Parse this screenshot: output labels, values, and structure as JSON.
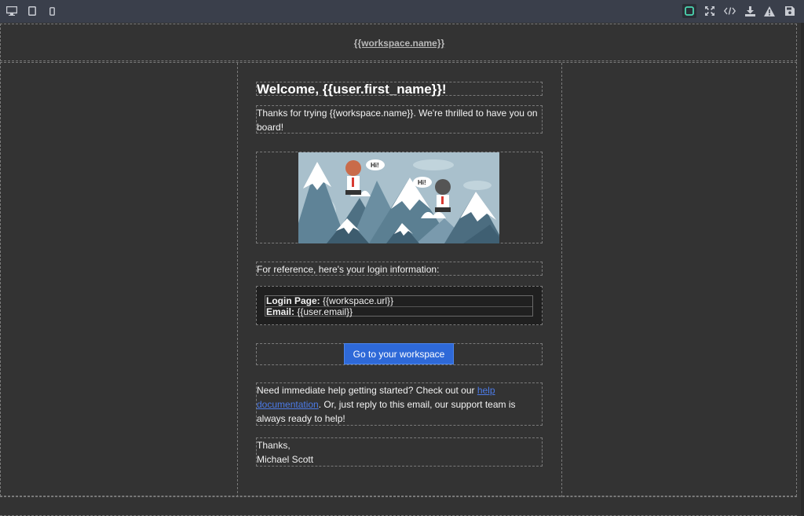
{
  "toolbar": {
    "left_icons": [
      "desktop-icon",
      "tablet-icon",
      "mobile-icon"
    ],
    "right_icons": [
      "outline-toggle-icon",
      "fullscreen-icon",
      "code-icon",
      "import-icon",
      "warning-icon",
      "save-icon"
    ]
  },
  "email": {
    "header_link": "{{workspace.name}}",
    "title": "Welcome, {{user.first_name}}!",
    "intro": "Thanks for trying {{workspace.name}}. We're thrilled to have you on board!",
    "image_alt": "Hi!",
    "bubble_1": "Hi!",
    "bubble_2": "Hi!",
    "reference_text": "For reference, here's your login information:",
    "login_page_label": "Login Page:",
    "login_page_value": "{{workspace.url}}",
    "email_label": "Email:",
    "email_value": "{{user.email}}",
    "cta_button": "Go to your workspace",
    "help_prefix": "Need immediate help getting started? Check out our ",
    "help_link": "help documentation",
    "help_suffix": ". Or, just reply to this email, our support team is always ready to help!",
    "signoff_1": "Thanks,",
    "signoff_2": "Michael Scott"
  },
  "colors": {
    "toolbar_bg": "#3a3f4b",
    "canvas_bg": "#333333",
    "button_bg": "#2e69d8",
    "link": "#4c7be8",
    "active_toggle": "#4bd6b1"
  }
}
